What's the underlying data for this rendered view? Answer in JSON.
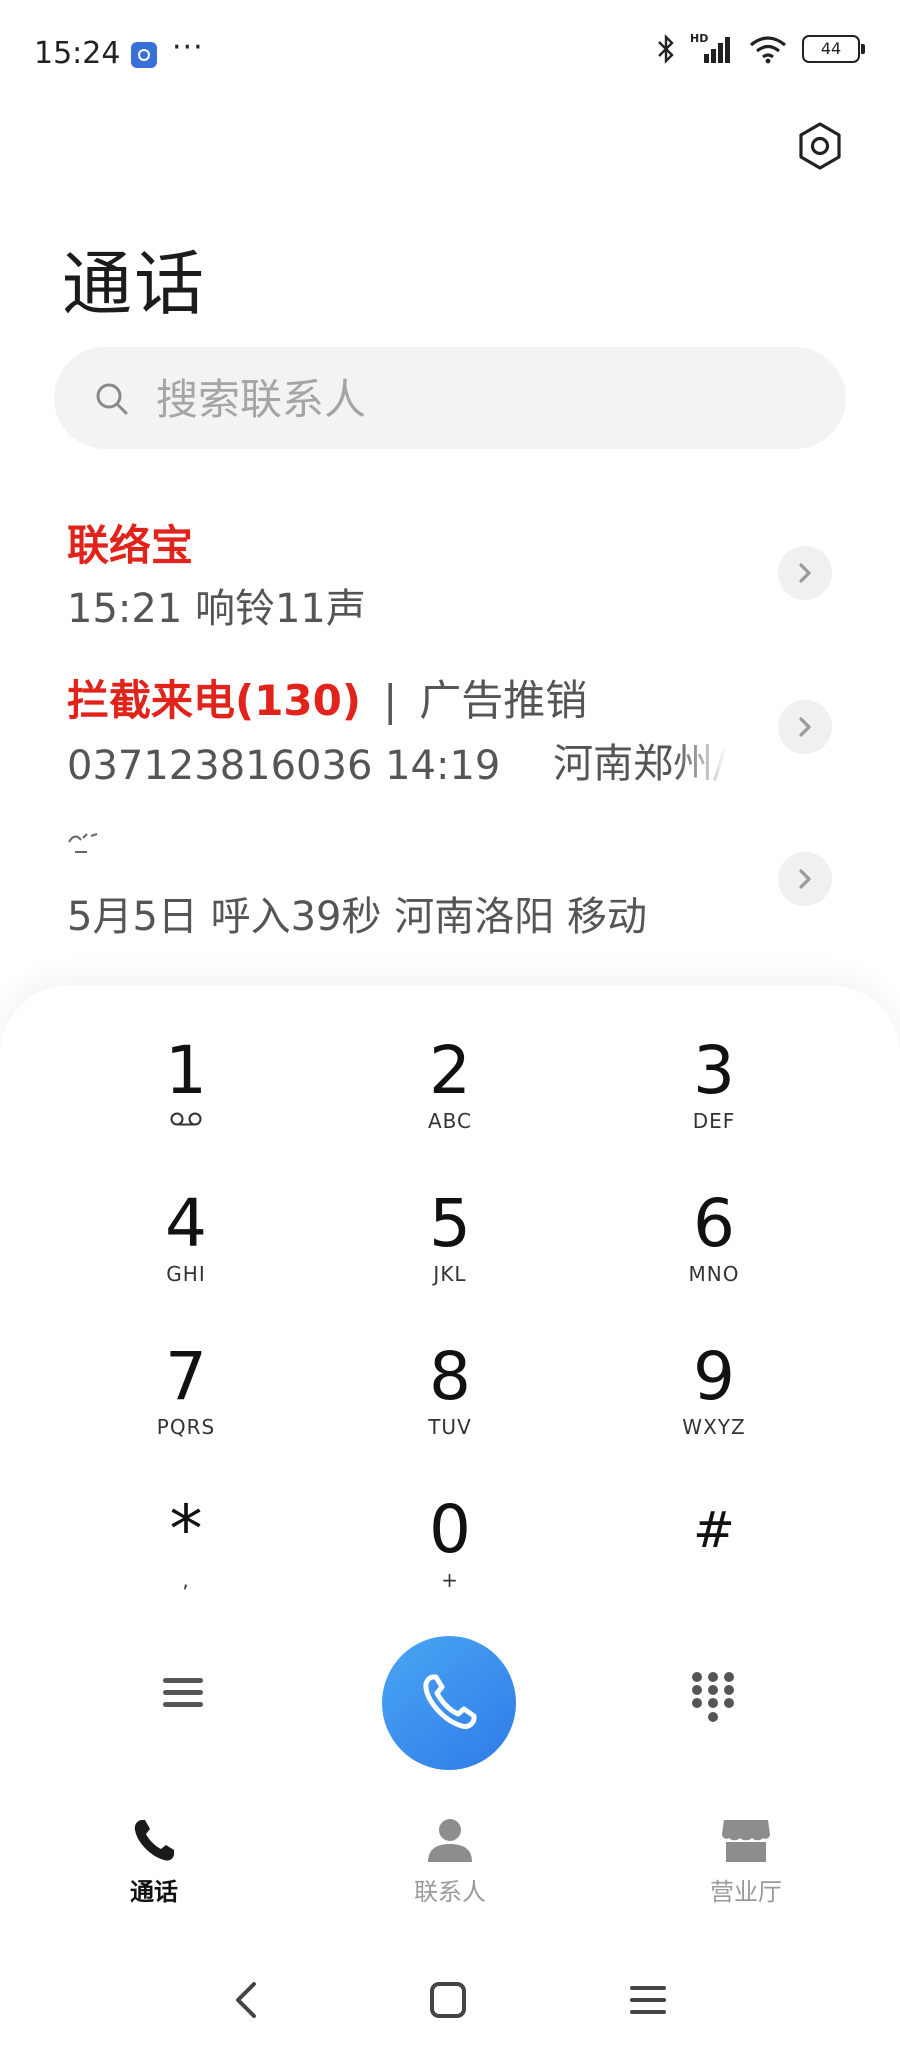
{
  "status_bar": {
    "time": "15:24",
    "more": "···",
    "network": "HD",
    "battery": "44",
    "icons": [
      "settings-app-icon",
      "bluetooth-icon",
      "signal-icon",
      "wifi-icon",
      "battery-icon"
    ]
  },
  "header": {
    "title": "通话",
    "settings_icon": "gear-icon"
  },
  "search": {
    "placeholder": "搜索联系人"
  },
  "call_log": [
    {
      "name": "联络宝",
      "detail": "15:21  响铃11声"
    },
    {
      "name": "拦截来电(130)",
      "separator": "|",
      "tag": "广告推销",
      "detail_number": "037123816036 14:19",
      "detail_location": "河南郑州/"
    },
    {
      "detail": "5月5日  呼入39秒 河南洛阳 移动"
    }
  ],
  "dialpad": {
    "keys": [
      {
        "digit": "1",
        "sub": ""
      },
      {
        "digit": "2",
        "sub": "ABC"
      },
      {
        "digit": "3",
        "sub": "DEF"
      },
      {
        "digit": "4",
        "sub": "GHI"
      },
      {
        "digit": "5",
        "sub": "JKL"
      },
      {
        "digit": "6",
        "sub": "MNO"
      },
      {
        "digit": "7",
        "sub": "PQRS"
      },
      {
        "digit": "8",
        "sub": "TUV"
      },
      {
        "digit": "9",
        "sub": "WXYZ"
      },
      {
        "digit": "*",
        "sub": ","
      },
      {
        "digit": "0",
        "sub": "+"
      },
      {
        "digit": "#",
        "sub": ""
      }
    ]
  },
  "bottom_nav": {
    "tabs": [
      {
        "label": "通话",
        "active": true
      },
      {
        "label": "联系人",
        "active": false
      },
      {
        "label": "营业厅",
        "active": false
      }
    ]
  },
  "colors": {
    "accent_red": "#e0241b",
    "call_button": "#3b8ef0"
  }
}
